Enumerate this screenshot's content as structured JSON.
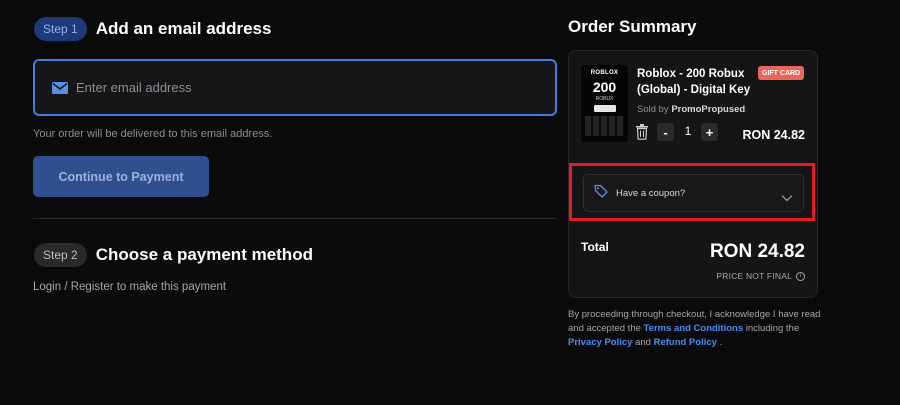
{
  "step1": {
    "badge": "Step 1",
    "title": "Add an email address"
  },
  "email": {
    "placeholder": "Enter email address",
    "value": "",
    "helper": "Your order will be delivered to this email address."
  },
  "continue_label": "Continue to Payment",
  "step2": {
    "badge": "Step 2",
    "title": "Choose a payment method",
    "subtitle": "Login / Register to make this payment"
  },
  "summary": {
    "title": "Order Summary",
    "product": {
      "thumb_brand": "ROBLOX",
      "thumb_amount": "200",
      "thumb_unit": "ROBUX",
      "title": "Roblox - 200 Robux (Global) - Digital Key",
      "badge": "GIFT CARD",
      "sold_by_prefix": "Sold by",
      "seller": "PromoPropused",
      "quantity": "1",
      "minus": "-",
      "plus": "+",
      "price": "RON 24.82"
    },
    "coupon_label": "Have a coupon?",
    "total_label": "Total",
    "total_value": "RON 24.82",
    "price_note": "PRICE NOT FINAL"
  },
  "legal": {
    "part1": "By proceeding through checkout, I acknowledge I have read and accepted the",
    "terms": "Terms and Conditions",
    "part2": "including the",
    "privacy": "Privacy Policy",
    "part3": "and",
    "refund": "Refund Policy",
    "part4": "."
  },
  "colors": {
    "accent": "#3d7fe0",
    "link": "#4a8cf2",
    "badge": "#e8665a",
    "highlight": "#e11d27"
  }
}
